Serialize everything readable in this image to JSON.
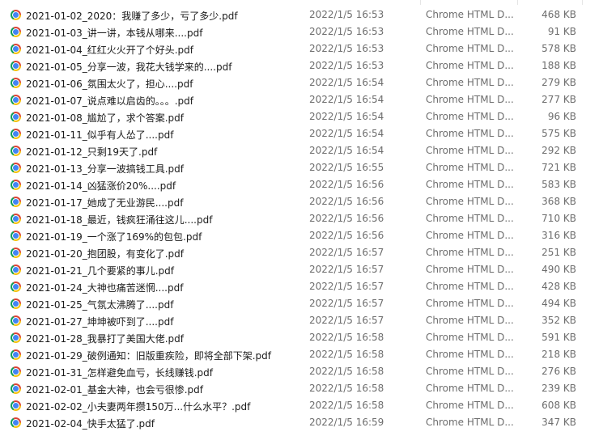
{
  "files": [
    {
      "name": "2021-01-02_2020：我赚了多少，亏了多少.pdf",
      "date": "2022/1/5 16:53",
      "type": "Chrome HTML D...",
      "size": "468 KB"
    },
    {
      "name": "2021-01-03_讲一讲，本钱从哪来....pdf",
      "date": "2022/1/5 16:53",
      "type": "Chrome HTML D...",
      "size": "91 KB"
    },
    {
      "name": "2021-01-04_红红火火开了个好头.pdf",
      "date": "2022/1/5 16:53",
      "type": "Chrome HTML D...",
      "size": "578 KB"
    },
    {
      "name": "2021-01-05_分享一波，我花大钱学来的....pdf",
      "date": "2022/1/5 16:53",
      "type": "Chrome HTML D...",
      "size": "188 KB"
    },
    {
      "name": "2021-01-06_氛围太火了，担心....pdf",
      "date": "2022/1/5 16:54",
      "type": "Chrome HTML D...",
      "size": "279 KB"
    },
    {
      "name": "2021-01-07_说点难以启齿的。。。.pdf",
      "date": "2022/1/5 16:54",
      "type": "Chrome HTML D...",
      "size": "277 KB"
    },
    {
      "name": "2021-01-08_尴尬了，求个答案.pdf",
      "date": "2022/1/5 16:54",
      "type": "Chrome HTML D...",
      "size": "96 KB"
    },
    {
      "name": "2021-01-11_似乎有人怂了....pdf",
      "date": "2022/1/5 16:54",
      "type": "Chrome HTML D...",
      "size": "575 KB"
    },
    {
      "name": "2021-01-12_只剩19天了.pdf",
      "date": "2022/1/5 16:54",
      "type": "Chrome HTML D...",
      "size": "292 KB"
    },
    {
      "name": "2021-01-13_分享一波搞钱工具.pdf",
      "date": "2022/1/5 16:55",
      "type": "Chrome HTML D...",
      "size": "721 KB"
    },
    {
      "name": "2021-01-14_凶猛涨价20%....pdf",
      "date": "2022/1/5 16:56",
      "type": "Chrome HTML D...",
      "size": "583 KB"
    },
    {
      "name": "2021-01-17_她成了无业游民....pdf",
      "date": "2022/1/5 16:56",
      "type": "Chrome HTML D...",
      "size": "368 KB"
    },
    {
      "name": "2021-01-18_最近，钱疯狂涌往这儿....pdf",
      "date": "2022/1/5 16:56",
      "type": "Chrome HTML D...",
      "size": "710 KB"
    },
    {
      "name": "2021-01-19_一个涨了169%的包包.pdf",
      "date": "2022/1/5 16:56",
      "type": "Chrome HTML D...",
      "size": "316 KB"
    },
    {
      "name": "2021-01-20_抱团股，有变化了.pdf",
      "date": "2022/1/5 16:57",
      "type": "Chrome HTML D...",
      "size": "251 KB"
    },
    {
      "name": "2021-01-21_几个要紧的事儿.pdf",
      "date": "2022/1/5 16:57",
      "type": "Chrome HTML D...",
      "size": "490 KB"
    },
    {
      "name": "2021-01-24_大神也痛苦迷惘....pdf",
      "date": "2022/1/5 16:57",
      "type": "Chrome HTML D...",
      "size": "428 KB"
    },
    {
      "name": "2021-01-25_气氛太沸腾了....pdf",
      "date": "2022/1/5 16:57",
      "type": "Chrome HTML D...",
      "size": "494 KB"
    },
    {
      "name": "2021-01-27_坤坤被吓到了....pdf",
      "date": "2022/1/5 16:57",
      "type": "Chrome HTML D...",
      "size": "352 KB"
    },
    {
      "name": "2021-01-28_我暴打了美国大佬.pdf",
      "date": "2022/1/5 16:58",
      "type": "Chrome HTML D...",
      "size": "591 KB"
    },
    {
      "name": "2021-01-29_破例通知：旧版重疾险，即将全部下架.pdf",
      "date": "2022/1/5 16:58",
      "type": "Chrome HTML D...",
      "size": "218 KB"
    },
    {
      "name": "2021-01-31_怎样避免血亏，长线赚钱.pdf",
      "date": "2022/1/5 16:58",
      "type": "Chrome HTML D...",
      "size": "276 KB"
    },
    {
      "name": "2021-02-01_基金大神，也会亏很惨.pdf",
      "date": "2022/1/5 16:58",
      "type": "Chrome HTML D...",
      "size": "239 KB"
    },
    {
      "name": "2021-02-02_小夫妻两年攒150万...什么水平？.pdf",
      "date": "2022/1/5 16:58",
      "type": "Chrome HTML D...",
      "size": "608 KB"
    },
    {
      "name": "2021-02-04_快手太猛了.pdf",
      "date": "2022/1/5 16:59",
      "type": "Chrome HTML D...",
      "size": "347 KB"
    }
  ]
}
